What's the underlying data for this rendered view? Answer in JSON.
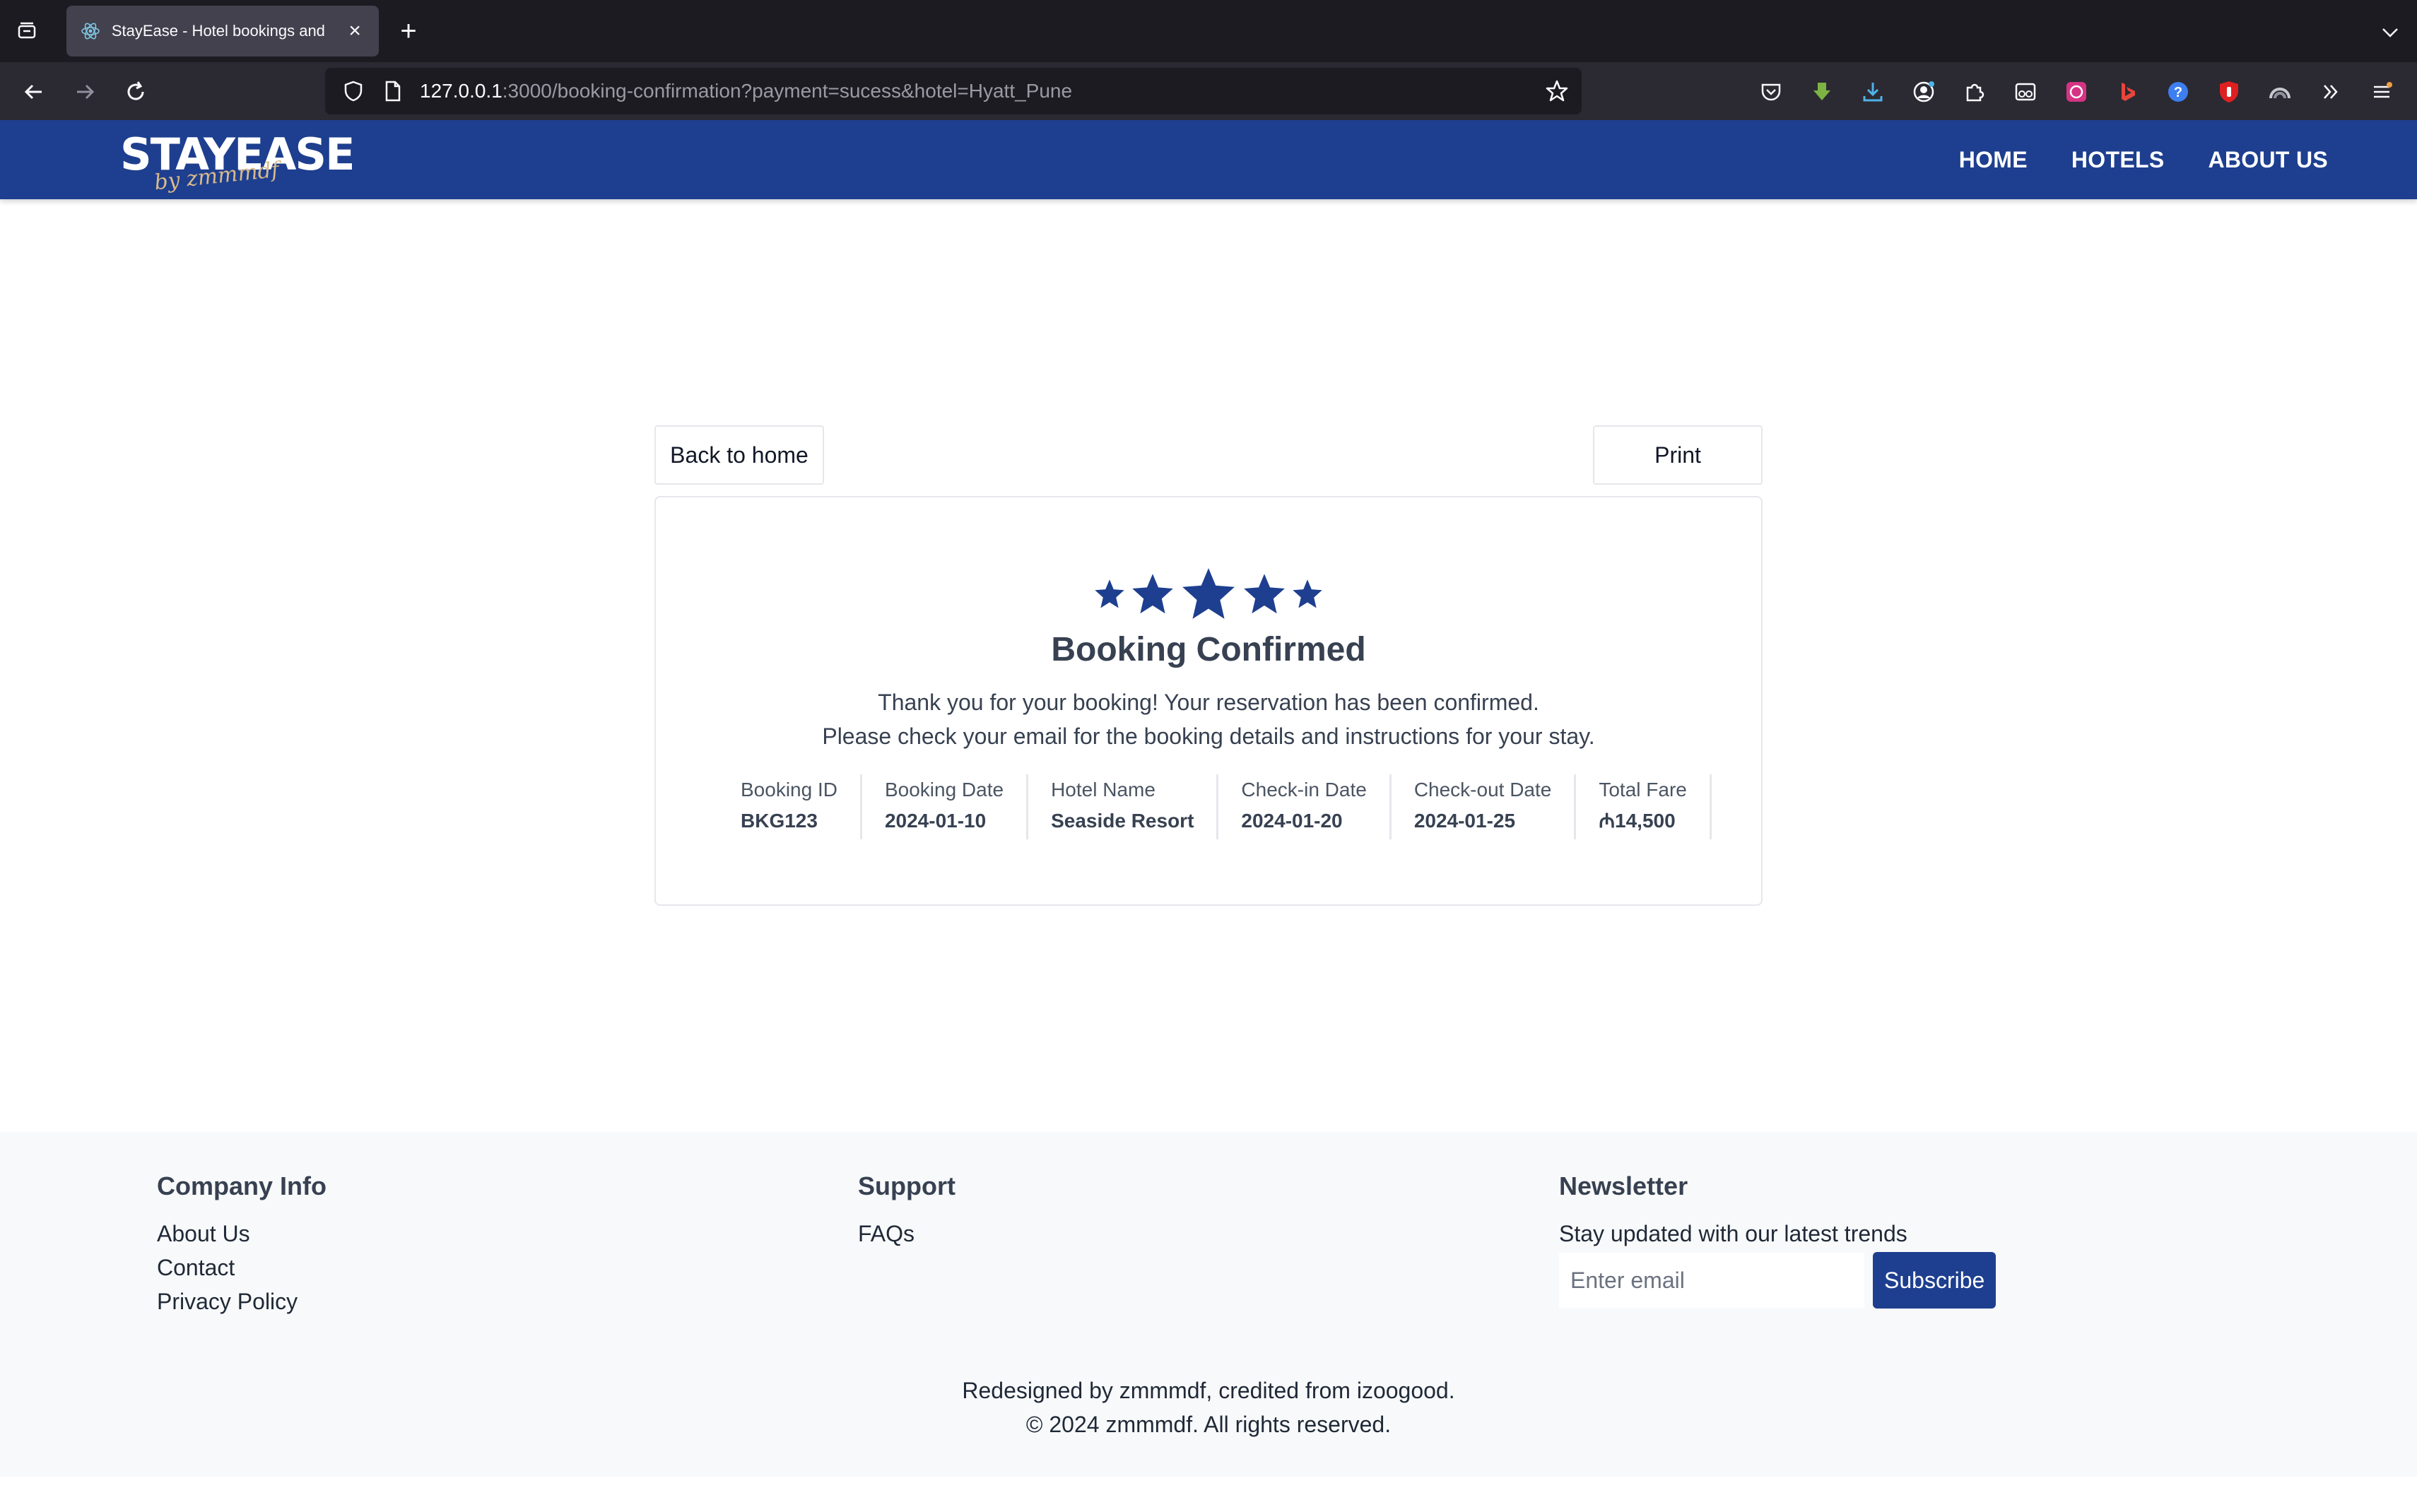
{
  "browser": {
    "tab_title": "StayEase - Hotel bookings and",
    "url_host": "127.0.0.1",
    "url_rest": ":3000/booking-confirmation?payment=sucess&hotel=Hyatt_Pune",
    "icons": [
      "tab-list-icon",
      "react-favicon-icon",
      "close-icon",
      "plus-icon",
      "chevron-down-icon",
      "back-arrow-icon",
      "forward-arrow-icon",
      "reload-icon",
      "shield-icon",
      "page-icon",
      "bookmark-star-icon",
      "pocket-icon",
      "download-arrow-icon",
      "downloads-icon",
      "account-icon",
      "extensions-icon",
      "reader-glasses-icon",
      "ai-extension-icon",
      "bing-icon",
      "help-icon",
      "ublock-icon",
      "rainbow-icon",
      "overflow-chevrons-icon",
      "app-menu-icon"
    ]
  },
  "header": {
    "logo_text": "STAYEASE",
    "logo_script": "by zmmmdf",
    "menu": [
      {
        "label": "HOME"
      },
      {
        "label": "HOTELS"
      },
      {
        "label": "ABOUT US"
      }
    ],
    "brand_color": "#1e3f8f"
  },
  "main": {
    "back_label": "Back to home",
    "print_label": "Print",
    "title": "Booking Confirmed",
    "message_line1": "Thank you for your booking! Your reservation has been confirmed.",
    "message_line2": "Please check your email for the booking details and instructions for your stay.",
    "star_rating": 5,
    "details": [
      {
        "label": "Booking ID",
        "value": "BKG123"
      },
      {
        "label": "Booking Date",
        "value": "2024-01-10"
      },
      {
        "label": "Hotel Name",
        "value": "Seaside Resort"
      },
      {
        "label": "Check-in Date",
        "value": "2024-01-20"
      },
      {
        "label": "Check-out Date",
        "value": "2024-01-25"
      },
      {
        "label": "Total Fare",
        "value": "₼14,500"
      }
    ]
  },
  "footer": {
    "company": {
      "heading": "Company Info",
      "links": [
        "About Us",
        "Contact",
        "Privacy Policy"
      ]
    },
    "support": {
      "heading": "Support",
      "links": [
        "FAQs"
      ]
    },
    "newsletter": {
      "heading": "Newsletter",
      "text": "Stay updated with our latest trends",
      "placeholder": "Enter email",
      "button": "Subscribe"
    },
    "credit": "Redesigned by zmmmdf, credited from izoogood.",
    "copyright": "© 2024 zmmmdf. All rights reserved."
  }
}
